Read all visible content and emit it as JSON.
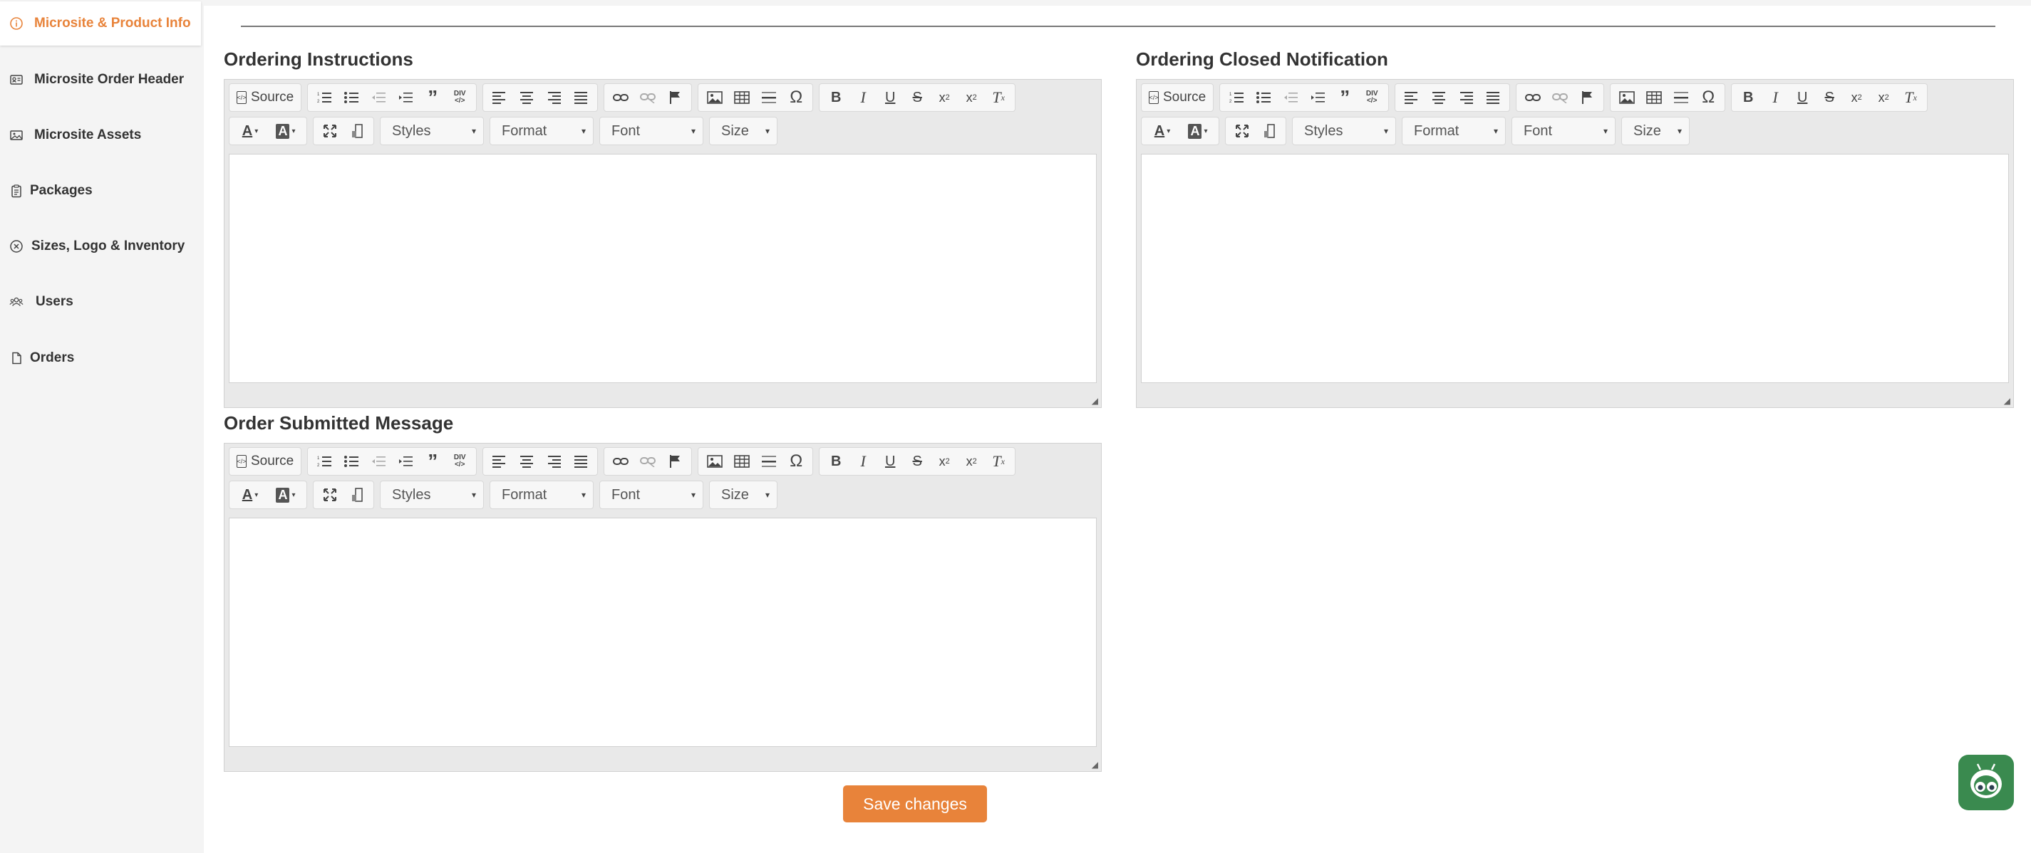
{
  "sidebar": {
    "items": [
      {
        "label": "Microsite & Product Info",
        "icon": "info-circle-icon",
        "active": true
      },
      {
        "label": "Microsite Order Header",
        "icon": "id-card-icon",
        "active": false
      },
      {
        "label": "Microsite Assets",
        "icon": "image-icon",
        "active": false
      },
      {
        "label": "Packages",
        "icon": "clipboard-icon",
        "active": false
      },
      {
        "label": "Sizes, Logo & Inventory",
        "icon": "circle-x-icon",
        "active": false
      },
      {
        "label": "Users",
        "icon": "users-icon",
        "active": false
      },
      {
        "label": "Orders",
        "icon": "file-icon",
        "active": false
      }
    ],
    "accent_color": "#e8833a"
  },
  "editors": [
    {
      "title": "Ordering Instructions"
    },
    {
      "title": "Ordering Closed Notification"
    },
    {
      "title": "Order Submitted Message"
    }
  ],
  "toolbar": {
    "source_label": "Source",
    "combos": {
      "styles": "Styles",
      "format": "Format",
      "font": "Font",
      "size": "Size"
    }
  },
  "actions": {
    "save_label": "Save changes",
    "save_color": "#e8833a"
  }
}
